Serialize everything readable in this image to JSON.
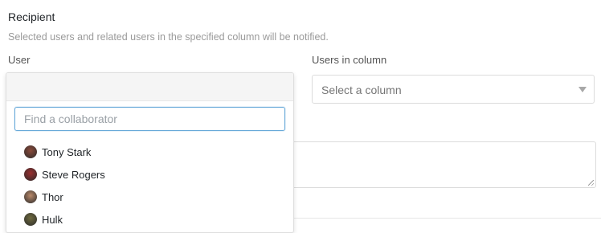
{
  "recipient": {
    "title": "Recipient",
    "description": "Selected users and related users in the specified column will be notified.",
    "user_label": "User",
    "column_label": "Users in column",
    "column_select": {
      "placeholder": "Select a column"
    }
  },
  "collaborator_dropdown": {
    "search_placeholder": "Find a collaborator",
    "users": [
      {
        "name": "Tony Stark",
        "avatar_color": "#8a4a3a"
      },
      {
        "name": "Steve Rogers",
        "avatar_color": "#9a2f2f"
      },
      {
        "name": "Thor",
        "avatar_color": "#b9896a"
      },
      {
        "name": "Hulk",
        "avatar_color": "#6f6a3e"
      }
    ]
  }
}
